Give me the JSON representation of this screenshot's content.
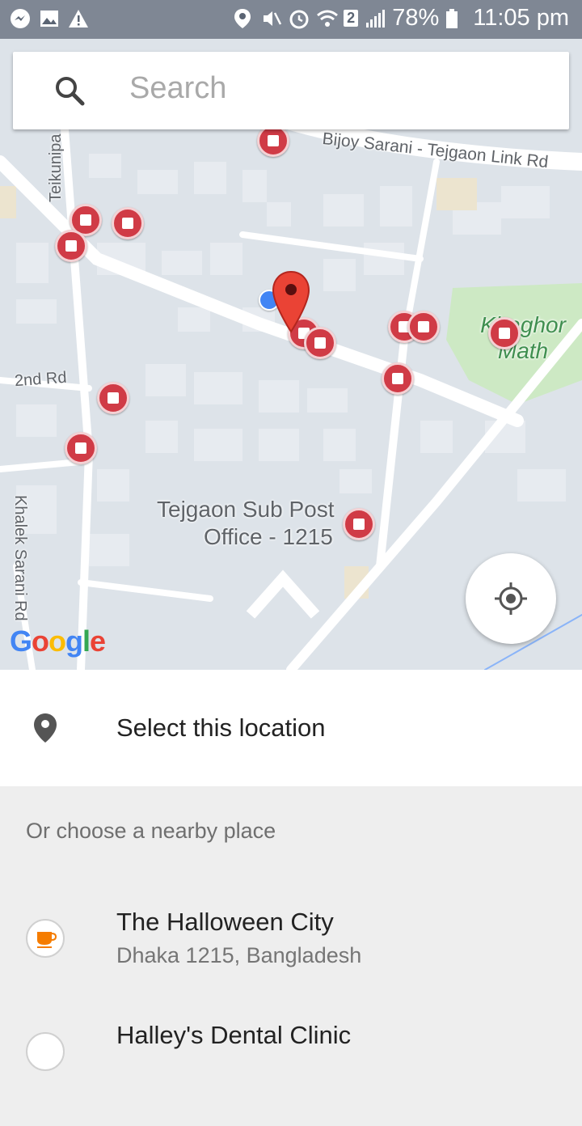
{
  "status_bar": {
    "battery": "78%",
    "time": "11:05 pm",
    "sim_badge": "2"
  },
  "search": {
    "placeholder": "Search"
  },
  "map": {
    "labels": {
      "road_top": "Bijoy Sarani - Tejgaon Link Rd",
      "road_left": "Teikunipa",
      "road_2nd": "2nd Rd",
      "road_khalek": "Khalek Sarani Rd",
      "park": "Khaghor Math",
      "post_office_line1": "Tejgaon Sub Post",
      "post_office_line2": "Office - 1215"
    },
    "attribution": "Google"
  },
  "select_location": {
    "label": "Select this location"
  },
  "nearby": {
    "heading": "Or choose a nearby place",
    "places": [
      {
        "name": "The Halloween City",
        "address": "Dhaka 1215, Bangladesh",
        "icon": "cafe-icon"
      },
      {
        "name": "Halley's Dental Clinic",
        "address": "",
        "icon": "place-icon"
      }
    ]
  },
  "colors": {
    "accent_red": "#d03b46",
    "pin_red": "#ea4335",
    "location_blue": "#4285f4",
    "park_green": "#c8e6c0",
    "cafe_orange": "#f57c00"
  }
}
